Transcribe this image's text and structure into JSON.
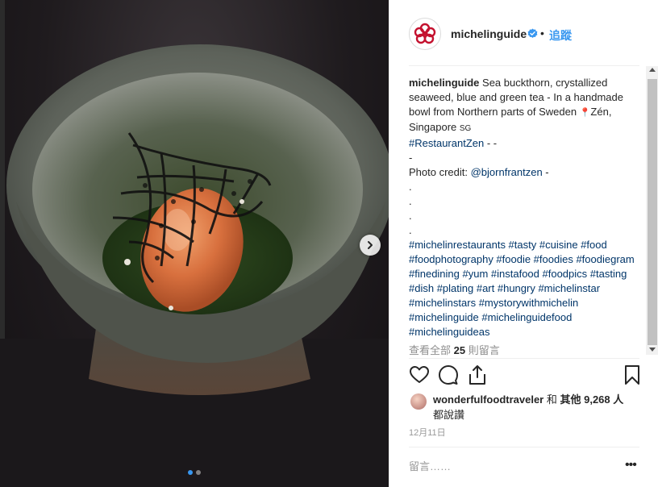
{
  "post": {
    "username": "michelinguide",
    "follow_label": "追蹤",
    "separator": "•",
    "caption": {
      "user": "michelinguide",
      "line1": " Sea buckthorn, crystallized seaweed, blue and green tea - In a handmade bowl from Northern parts of Sweden ",
      "pin": "📍",
      "location": "Zén, Singapore ",
      "flag": "SG",
      "hashtag_restaurant": "#RestaurantZen",
      "after_restaurant": " - -",
      "dash": "-",
      "photo_credit_prefix": "Photo credit: ",
      "photo_credit_user": "@bjornfrantzen",
      "photo_credit_suffix": " -",
      "dots": [
        ".",
        ".",
        ".",
        "."
      ],
      "hashtags": "#michelinrestaurants #tasty #cuisine #food #foodphotography #foodie #foodies #foodiegram #finedining #yum #instafood #foodpics #tasting #dish #plating #art #hungry #michelinstar #michelinstars #mystorywithmichelin #michelinguide #michelinguidefood #michelinguideas"
    },
    "more_comments": {
      "prefix": "查看全部 ",
      "count": "25",
      "suffix": " 則留言"
    },
    "likes": {
      "user": "wonderfulfoodtraveler",
      "and": " 和 ",
      "others": "其他 9,268 人",
      "said": "都說讚"
    },
    "timestamp": "12月11日",
    "comment_placeholder": "留言……",
    "more_options": "•••"
  },
  "carousel": {
    "slide_count": 2,
    "active_index": 0
  },
  "colors": {
    "accent": "#3897f0",
    "hashtag": "#003569",
    "michelin_red": "#c4122f",
    "muted": "#8e8e8e"
  },
  "icons": {
    "verified": "verified-badge-icon",
    "like": "heart-icon",
    "comment": "comment-bubble-icon",
    "share": "share-icon",
    "save": "bookmark-icon",
    "next": "chevron-right-icon",
    "avatar_logo": "michelin-star-logo"
  }
}
